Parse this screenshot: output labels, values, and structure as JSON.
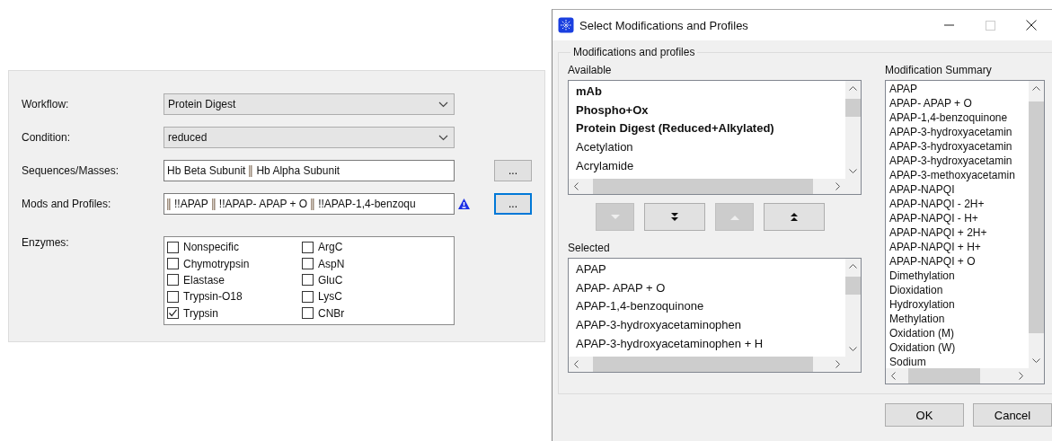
{
  "main_form": {
    "fields": [
      {
        "label": "Workflow:",
        "kind": "dropdown",
        "value": "Protein Digest"
      },
      {
        "label": "Condition:",
        "kind": "dropdown",
        "value": "reduced"
      },
      {
        "label": "Sequences/Masses:",
        "kind": "token_field",
        "tokens": [
          {
            "kind": "text",
            "text": "Hb Beta Subunit"
          },
          {
            "kind": "separator"
          },
          {
            "kind": "text",
            "text": "Hb Alpha Subunit"
          }
        ],
        "browse_button": {
          "label": "...",
          "focused": false
        }
      },
      {
        "label": "Mods and Profiles:",
        "kind": "token_field",
        "tokens": [
          {
            "kind": "separator"
          },
          {
            "kind": "text",
            "text": "!!APAP"
          },
          {
            "kind": "separator"
          },
          {
            "kind": "text",
            "text": "!!APAP- APAP + O"
          },
          {
            "kind": "separator"
          },
          {
            "kind": "text",
            "text": "!!APAP-1,4-benzoqu"
          }
        ],
        "warning": true,
        "browse_button": {
          "label": "...",
          "focused": true
        }
      }
    ],
    "enzymes": {
      "label": "Enzymes:",
      "items": [
        {
          "label": "Nonspecific",
          "checked": false
        },
        {
          "label": "Chymotrypsin",
          "checked": false
        },
        {
          "label": "Elastase",
          "checked": false
        },
        {
          "label": "Trypsin-O18",
          "checked": false
        },
        {
          "label": "Trypsin",
          "checked": true
        },
        {
          "label": "ArgC",
          "checked": false
        },
        {
          "label": "AspN",
          "checked": false
        },
        {
          "label": "GluC",
          "checked": false
        },
        {
          "label": "LysC",
          "checked": false
        },
        {
          "label": "CNBr",
          "checked": false
        }
      ]
    }
  },
  "dialog": {
    "title": "Select Modifications and Profiles",
    "window_buttons": [
      {
        "kind": "minimize",
        "disabled": false
      },
      {
        "kind": "maximize",
        "disabled": true
      },
      {
        "kind": "close",
        "disabled": false
      }
    ],
    "group": {
      "title": "Modifications and profiles",
      "available": {
        "label": "Available",
        "items": [
          {
            "text": "mAb",
            "kind": "profile"
          },
          {
            "text": "Phospho+Ox",
            "kind": "profile"
          },
          {
            "text": "Protein Digest (Reduced+Alkylated)",
            "kind": "profile"
          },
          {
            "text": "Acetylation",
            "kind": "modification"
          },
          {
            "text": "Acrylamide",
            "kind": "modification"
          }
        ]
      },
      "move_buttons": [
        {
          "kind": "move-down",
          "disabled": true
        },
        {
          "kind": "move-all-down",
          "disabled": false
        },
        {
          "kind": "move-up",
          "disabled": true
        },
        {
          "kind": "move-all-up",
          "disabled": false
        }
      ],
      "selected": {
        "label": "Selected",
        "items": [
          "APAP",
          "APAP- APAP + O",
          "APAP-1,4-benzoquinone",
          "APAP-3-hydroxyacetaminophen",
          "APAP-3-hydroxyacetaminophen + H"
        ]
      },
      "summary": {
        "label": "Modification Summary",
        "items": [
          "APAP",
          "APAP- APAP + O",
          "APAP-1,4-benzoquinone",
          "APAP-3-hydroxyacetamin",
          "APAP-3-hydroxyacetamin",
          "APAP-3-hydroxyacetamin",
          "APAP-3-methoxyacetamin",
          "APAP-NAPQI",
          "APAP-NAPQI - 2H+",
          "APAP-NAPQI - H+",
          "APAP-NAPQI + 2H+",
          "APAP-NAPQI + H+",
          "APAP-NAPQI + O",
          "Dimethylation",
          "Dioxidation",
          "Hydroxylation",
          "Methylation",
          "Oxidation (M)",
          "Oxidation (W)",
          "Sodium"
        ]
      }
    },
    "buttons": [
      {
        "label": "OK"
      },
      {
        "label": "Cancel"
      }
    ]
  }
}
